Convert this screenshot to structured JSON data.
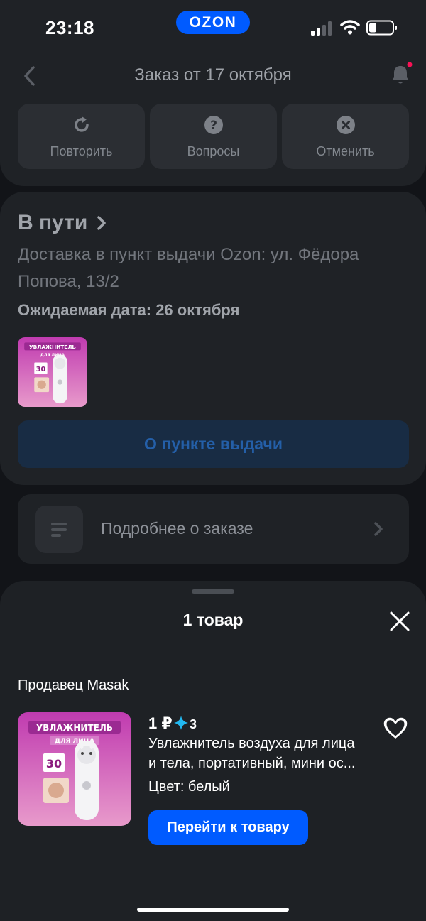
{
  "status_bar": {
    "time": "23:18",
    "logo_text": "OZON",
    "brand_color": "#005bff",
    "icons": [
      "signal-icon",
      "wifi-icon",
      "battery-icon"
    ]
  },
  "header": {
    "title": "Заказ от 17 октября",
    "icons": [
      "chevron-left-icon",
      "bell-icon"
    ],
    "notification_dot_color": "#f91155"
  },
  "actions": [
    {
      "label": "Повторить",
      "icon": "repeat-icon"
    },
    {
      "label": "Вопросы",
      "icon": "question-icon"
    },
    {
      "label": "Отменить",
      "icon": "cancel-icon"
    }
  ],
  "shipment": {
    "status": "В пути",
    "address": "Доставка в пункт выдачи Ozon: ул. Фёдора Попова, 13/2",
    "expected_date": "Ожидаемая дата: 26 октября",
    "pickup_button": "О пункте выдачи"
  },
  "details": {
    "label": "Подробнее о заказе",
    "icon": "list-icon"
  },
  "sheet": {
    "title": "1 товар",
    "seller": "Продавец Masak",
    "product": {
      "price": "1 ₽",
      "rating": "3",
      "name_line1": "Увлажнитель воздуха для лица",
      "name_line2": "и тела, портативный, мини ос...",
      "color": "Цвет: белый",
      "image_text": "УВЛАЖНИТЕЛЬ",
      "image_subtext": "ДЛЯ ЛИЦА",
      "image_badge": "30",
      "button": "Перейти к товару"
    }
  }
}
